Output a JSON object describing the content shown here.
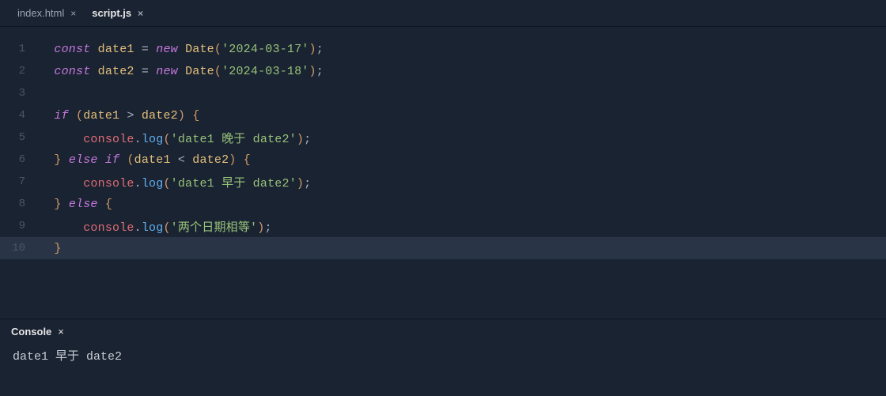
{
  "tabs": [
    {
      "label": "index.html",
      "active": false
    },
    {
      "label": "script.js",
      "active": true
    }
  ],
  "code": {
    "lines": [
      {
        "n": "1",
        "tokens": [
          {
            "t": "const ",
            "c": "tk-keyword"
          },
          {
            "t": "date1",
            "c": "tk-ident"
          },
          {
            "t": " = ",
            "c": "tk-op"
          },
          {
            "t": "new ",
            "c": "tk-new"
          },
          {
            "t": "Date",
            "c": "tk-class"
          },
          {
            "t": "(",
            "c": "tk-paren"
          },
          {
            "t": "'2024-03-17'",
            "c": "tk-string"
          },
          {
            "t": ")",
            "c": "tk-paren"
          },
          {
            "t": ";",
            "c": "tk-punct"
          }
        ]
      },
      {
        "n": "2",
        "tokens": [
          {
            "t": "const ",
            "c": "tk-keyword"
          },
          {
            "t": "date2",
            "c": "tk-ident"
          },
          {
            "t": " = ",
            "c": "tk-op"
          },
          {
            "t": "new ",
            "c": "tk-new"
          },
          {
            "t": "Date",
            "c": "tk-class"
          },
          {
            "t": "(",
            "c": "tk-paren"
          },
          {
            "t": "'2024-03-18'",
            "c": "tk-string"
          },
          {
            "t": ")",
            "c": "tk-paren"
          },
          {
            "t": ";",
            "c": "tk-punct"
          }
        ]
      },
      {
        "n": "3",
        "tokens": []
      },
      {
        "n": "4",
        "tokens": [
          {
            "t": "if ",
            "c": "tk-if"
          },
          {
            "t": "(",
            "c": "tk-paren"
          },
          {
            "t": "date1",
            "c": "tk-ident"
          },
          {
            "t": " > ",
            "c": "tk-op"
          },
          {
            "t": "date2",
            "c": "tk-ident"
          },
          {
            "t": ")",
            "c": "tk-paren"
          },
          {
            "t": " {",
            "c": "tk-brace"
          }
        ]
      },
      {
        "n": "5",
        "indent": 1,
        "tokens": [
          {
            "t": "console",
            "c": "tk-obj"
          },
          {
            "t": ".",
            "c": "tk-punct"
          },
          {
            "t": "log",
            "c": "tk-prop"
          },
          {
            "t": "(",
            "c": "tk-paren"
          },
          {
            "t": "'date1 晚于 date2'",
            "c": "tk-string"
          },
          {
            "t": ")",
            "c": "tk-paren"
          },
          {
            "t": ";",
            "c": "tk-punct"
          }
        ]
      },
      {
        "n": "6",
        "tokens": [
          {
            "t": "}",
            "c": "tk-brace"
          },
          {
            "t": " ",
            "c": "tk-op"
          },
          {
            "t": "else if ",
            "c": "tk-if"
          },
          {
            "t": "(",
            "c": "tk-paren"
          },
          {
            "t": "date1",
            "c": "tk-ident"
          },
          {
            "t": " < ",
            "c": "tk-op"
          },
          {
            "t": "date2",
            "c": "tk-ident"
          },
          {
            "t": ")",
            "c": "tk-paren"
          },
          {
            "t": " {",
            "c": "tk-brace"
          }
        ]
      },
      {
        "n": "7",
        "indent": 1,
        "tokens": [
          {
            "t": "console",
            "c": "tk-obj"
          },
          {
            "t": ".",
            "c": "tk-punct"
          },
          {
            "t": "log",
            "c": "tk-prop"
          },
          {
            "t": "(",
            "c": "tk-paren"
          },
          {
            "t": "'date1 早于 date2'",
            "c": "tk-string"
          },
          {
            "t": ")",
            "c": "tk-paren"
          },
          {
            "t": ";",
            "c": "tk-punct"
          }
        ]
      },
      {
        "n": "8",
        "tokens": [
          {
            "t": "}",
            "c": "tk-brace"
          },
          {
            "t": " ",
            "c": "tk-op"
          },
          {
            "t": "else ",
            "c": "tk-if"
          },
          {
            "t": "{",
            "c": "tk-brace"
          }
        ]
      },
      {
        "n": "9",
        "indent": 1,
        "tokens": [
          {
            "t": "console",
            "c": "tk-obj"
          },
          {
            "t": ".",
            "c": "tk-punct"
          },
          {
            "t": "log",
            "c": "tk-prop"
          },
          {
            "t": "(",
            "c": "tk-paren"
          },
          {
            "t": "'两个日期相等'",
            "c": "tk-string"
          },
          {
            "t": ")",
            "c": "tk-paren"
          },
          {
            "t": ";",
            "c": "tk-punct"
          }
        ]
      },
      {
        "n": "10",
        "highlight": true,
        "tokens": [
          {
            "t": "}",
            "c": "tk-brace"
          }
        ]
      }
    ]
  },
  "console": {
    "title": "Console",
    "output": "date1 早于 date2"
  }
}
